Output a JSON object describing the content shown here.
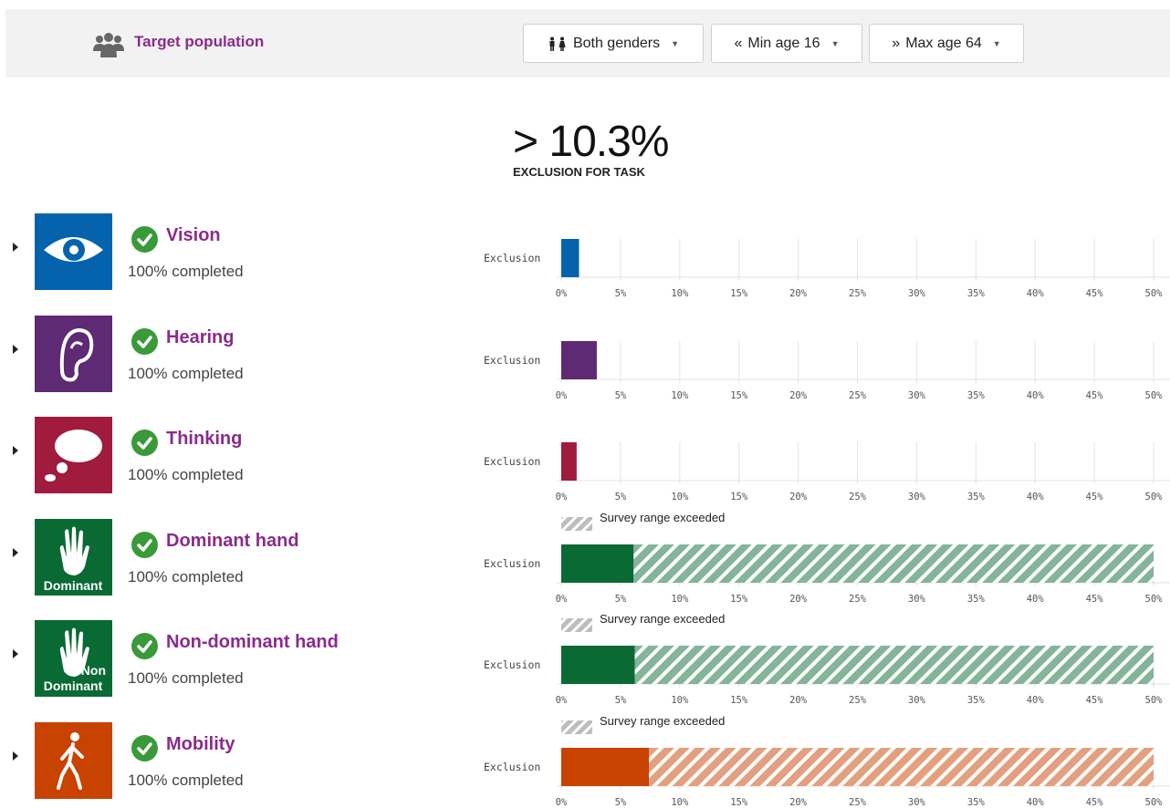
{
  "topbar": {
    "target_label": "Target population",
    "gender_label": "Both genders",
    "min_age_label": "Min age 16",
    "max_age_label": "Max age 64",
    "min_prefix": "«",
    "max_prefix": "»"
  },
  "summary": {
    "value": "> 10.3%",
    "caption": "EXCLUSION FOR TASK"
  },
  "axis_ticks": [
    "0%",
    "5%",
    "10%",
    "15%",
    "20%",
    "25%",
    "30%",
    "35%",
    "40%",
    "45%",
    "50%"
  ],
  "bar_label": "Exclusion",
  "legend_text": "Survey range exceeded",
  "categories": [
    {
      "name": "Vision",
      "status": "100% completed",
      "color": "#0563ad",
      "icon": "eye-icon",
      "exclusion_pct": 1.5,
      "range_exceeded": false
    },
    {
      "name": "Hearing",
      "status": "100% completed",
      "color": "#5e2a73",
      "icon": "ear-icon",
      "exclusion_pct": 3.0,
      "range_exceeded": false
    },
    {
      "name": "Thinking",
      "status": "100% completed",
      "color": "#a01b3e",
      "icon": "thought-bubble-icon",
      "exclusion_pct": 1.3,
      "range_exceeded": false
    },
    {
      "name": "Dominant hand",
      "status": "100% completed",
      "color": "#0a6a34",
      "icon": "hand-icon",
      "tile_text": [
        "Dominant"
      ],
      "exclusion_pct": 6.1,
      "range_exceeded": true
    },
    {
      "name": "Non-dominant hand",
      "status": "100% completed",
      "color": "#0a6a34",
      "icon": "hand-icon",
      "tile_text": [
        "Non",
        "Dominant"
      ],
      "exclusion_pct": 6.2,
      "range_exceeded": true
    },
    {
      "name": "Mobility",
      "status": "100% completed",
      "color": "#c84200",
      "icon": "walking-person-icon",
      "exclusion_pct": 7.4,
      "range_exceeded": true
    }
  ]
}
